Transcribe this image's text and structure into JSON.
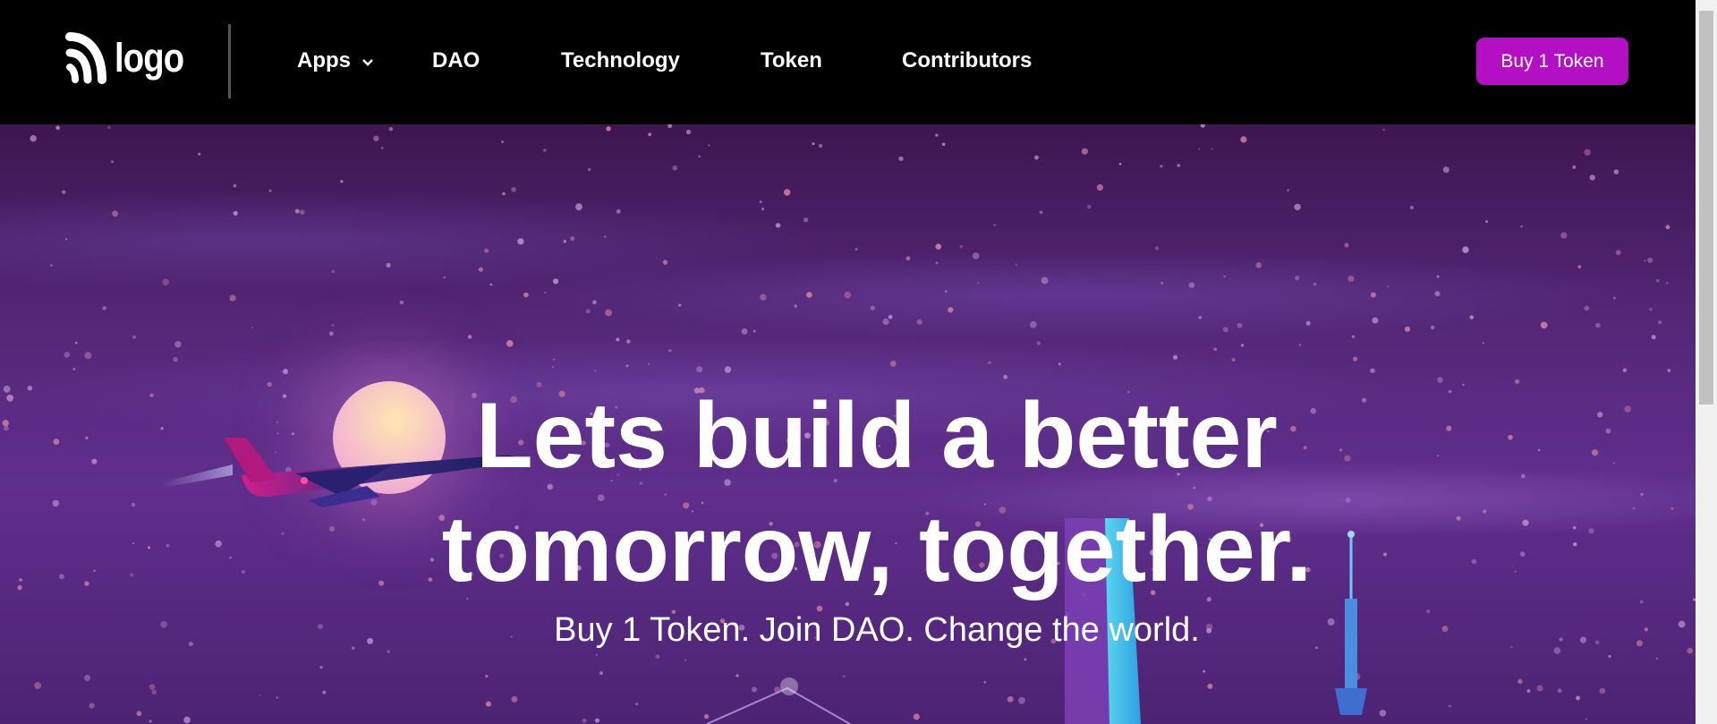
{
  "header": {
    "logo_text": "logo",
    "nav": [
      {
        "label": "Apps",
        "has_dropdown": true
      },
      {
        "label": "DAO"
      },
      {
        "label": "Technology"
      },
      {
        "label": "Token"
      },
      {
        "label": "Contributors"
      }
    ],
    "cta_label": "Buy 1 Token"
  },
  "hero": {
    "headline_line1": "Lets build a better",
    "headline_line2": "tomorrow, together.",
    "subheadline": "Buy 1 Token. Join DAO. Change the world."
  },
  "colors": {
    "cta_bg": "#b30fc3",
    "header_bg": "#000000",
    "hero_purple": "#5f2f8c"
  },
  "icons": [
    "logo-mark-icon",
    "chevron-down-icon"
  ]
}
